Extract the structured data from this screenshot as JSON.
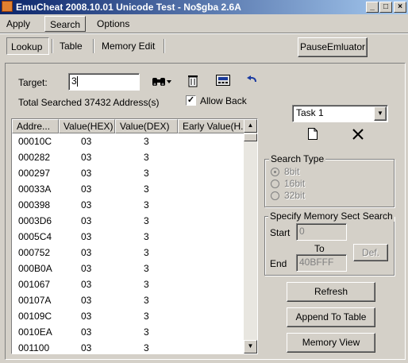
{
  "window": {
    "title": "EmuCheat 2008.10.01 Unicode Test - No$gba 2.6A"
  },
  "menu": {
    "items": [
      {
        "label": "Apply"
      },
      {
        "label": "Search"
      },
      {
        "label": "Options"
      }
    ]
  },
  "subtabs": {
    "items": [
      {
        "label": "Lookup"
      },
      {
        "label": "Table"
      },
      {
        "label": "Memory Edit"
      }
    ]
  },
  "pause_button": "PauseEmluator",
  "search": {
    "target_label": "Target:",
    "target_value": "3",
    "total_text": "Total Searched 37432 Address(s)",
    "allow_back_label": "Allow Back",
    "allow_back_checked": true
  },
  "list": {
    "columns": [
      "Addre...",
      "Value(HEX)",
      "Value(DEX)",
      "Early Value(H..."
    ],
    "rows": [
      [
        "00010C",
        "03",
        "3"
      ],
      [
        "000282",
        "03",
        "3"
      ],
      [
        "000297",
        "03",
        "3"
      ],
      [
        "00033A",
        "03",
        "3"
      ],
      [
        "000398",
        "03",
        "3"
      ],
      [
        "0003D6",
        "03",
        "3"
      ],
      [
        "0005C4",
        "03",
        "3"
      ],
      [
        "000752",
        "03",
        "3"
      ],
      [
        "000B0A",
        "03",
        "3"
      ],
      [
        "001067",
        "03",
        "3"
      ],
      [
        "00107A",
        "03",
        "3"
      ],
      [
        "00109C",
        "03",
        "3"
      ],
      [
        "0010EA",
        "03",
        "3"
      ],
      [
        "001100",
        "03",
        "3"
      ]
    ]
  },
  "task": {
    "selected": "Task 1"
  },
  "search_type": {
    "title": "Search Type",
    "options": [
      {
        "label": "8bit"
      },
      {
        "label": "16bit"
      },
      {
        "label": "32bit"
      }
    ],
    "selected": "8bit"
  },
  "memory_sect": {
    "title": "Specify Memory Sect Search",
    "start_label": "Start",
    "start_value": "0",
    "to_label": "To",
    "end_label": "End",
    "end_value": "40BFFF",
    "def_label": "Def."
  },
  "buttons": {
    "refresh": "Refresh",
    "append": "Append To Table",
    "memory_view": "Memory View"
  },
  "icons": {
    "find": "binoculars-icon",
    "delete": "trash-icon",
    "calc": "calculator-icon",
    "undo": "undo-icon",
    "new": "new-document-icon",
    "close": "close-x-icon"
  }
}
